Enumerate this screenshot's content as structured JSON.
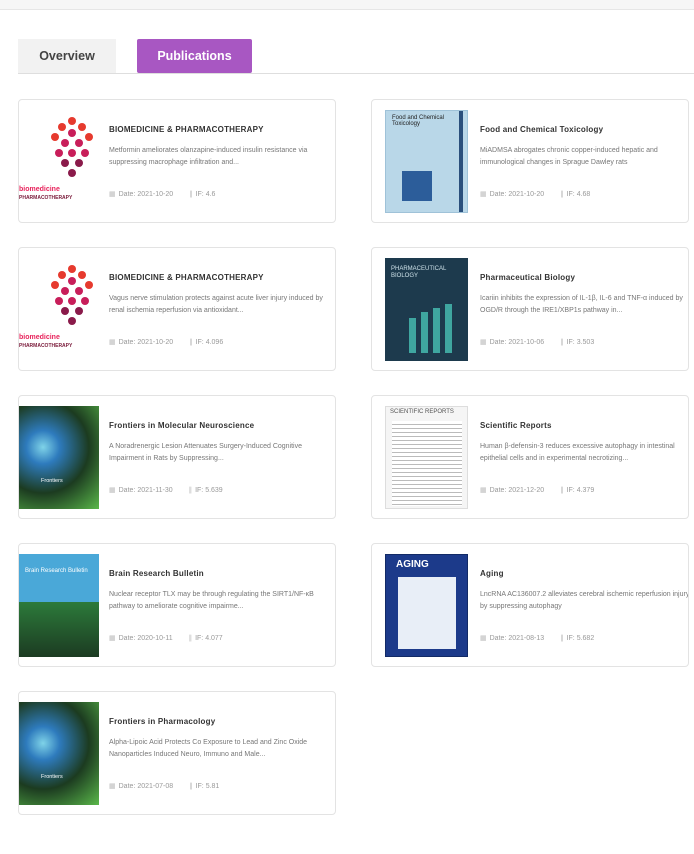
{
  "tabs": {
    "overview": "Overview",
    "publications": "Publications"
  },
  "meta_labels": {
    "date_prefix": "Date: ",
    "if_prefix": "IF: "
  },
  "colors": {
    "accent": "#a857c2",
    "border": "#e3e3e3"
  },
  "publications": [
    {
      "journal": "BIOMEDICINE & PHARMACOTHERAPY",
      "description": "Metformin ameliorates olanzapine-induced insulin resistance via suppressing macrophage infiltration and...",
      "date": "2021-10-20",
      "if": "4.6"
    },
    {
      "journal": "Food and Chemical Toxicology",
      "description": "MiADMSA abrogates chronic copper-induced hepatic and immunological changes in Sprague Dawley rats",
      "date": "2021-10-20",
      "if": "4.68"
    },
    {
      "journal": "BIOMEDICINE & PHARMACOTHERAPY",
      "description": "Vagus nerve stimulation protects against acute liver injury induced by renal ischemia reperfusion via antioxidant...",
      "date": "2021-10-20",
      "if": "4.096"
    },
    {
      "journal": "Pharmaceutical Biology",
      "description": "Icariin inhibits the expression of IL-1β, IL-6 and TNF-α induced by OGD/R through the IRE1/XBP1s pathway in...",
      "date": "2021-10-06",
      "if": "3.503"
    },
    {
      "journal": "Frontiers in Molecular Neuroscience",
      "description": "A Noradrenergic Lesion Attenuates Surgery-Induced Cognitive Impairment in Rats by Suppressing...",
      "date": "2021-11-30",
      "if": "5.639"
    },
    {
      "journal": "Scientific Reports",
      "description": "Human β-defensin-3 reduces excessive autophagy in intestinal epithelial cells and in experimental necrotizing...",
      "date": "2021-12-20",
      "if": "4.379"
    },
    {
      "journal": "Brain Research Bulletin",
      "description": "Nuclear receptor TLX may be through regulating the SIRT1/NF-κB pathway to ameliorate cognitive impairme...",
      "date": "2020-10-11",
      "if": "4.077"
    },
    {
      "journal": "Aging",
      "description": "LncRNA AC136007.2 alleviates cerebral ischemic reperfusion injury by suppressing autophagy",
      "date": "2021-08-13",
      "if": "5.682"
    },
    {
      "journal": "Frontiers in Pharmacology",
      "description": "Alpha-Lipoic Acid Protects Co Exposure to Lead and Zinc Oxide Nanoparticles Induced Neuro, Immuno and Male...",
      "date": "2021-07-08",
      "if": "5.81"
    }
  ],
  "covers": {
    "biomed": {
      "brand": "biomedicine",
      "sub": "PHARMACOTHERAPY"
    },
    "fct": {
      "head": "Food and Chemical Toxicology"
    },
    "pb": {
      "head": "PHARMACEUTICAL BIOLOGY"
    },
    "frontiers": {
      "text": "Frontiers"
    },
    "sr": {
      "head": "SCIENTIFIC REPORTS"
    },
    "brb": {
      "title": "Brain Research Bulletin"
    },
    "aging": {
      "head": "AGING"
    }
  }
}
